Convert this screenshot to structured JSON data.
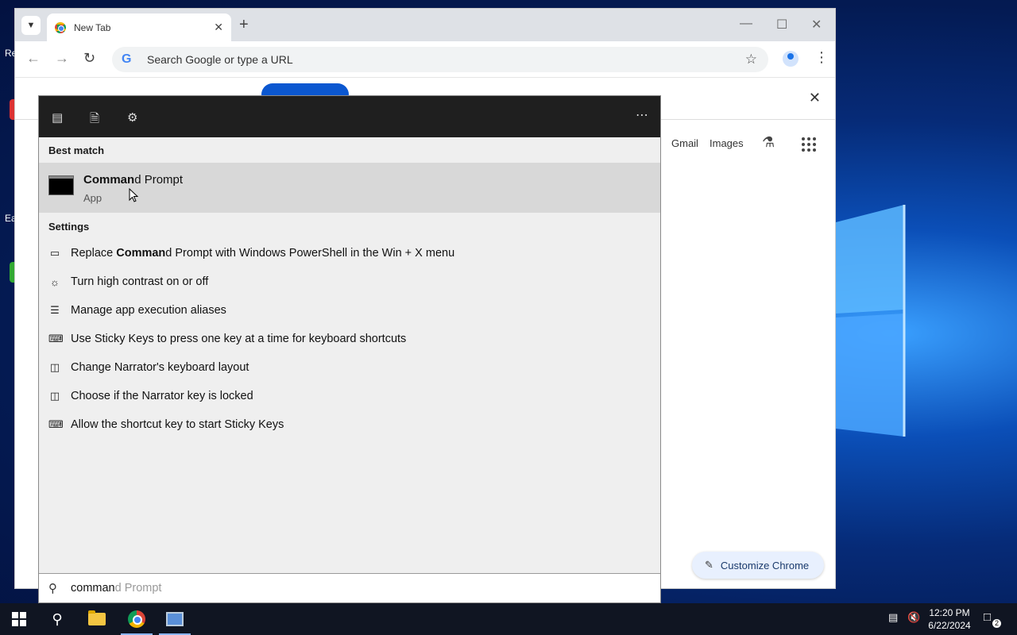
{
  "desktop": {
    "labels": [
      "Re",
      "Ea"
    ]
  },
  "browser": {
    "tab_title": "New Tab",
    "omnibox_placeholder": "Search Google or type a URL",
    "top_links": [
      "Gmail",
      "Images"
    ],
    "customize_label": "Customize Chrome"
  },
  "search_panel": {
    "best_match_heading": "Best match",
    "best_match": {
      "title_bold": "Comman",
      "title_rest": "d Prompt",
      "subtitle": "App"
    },
    "settings_heading": "Settings",
    "settings": [
      {
        "icon": "keyboard-icon",
        "pre": "Replace ",
        "bold": "Comman",
        "post": "d Prompt with Windows PowerShell in the Win + X menu"
      },
      {
        "icon": "sun-icon",
        "pre": "Turn high contrast on or off",
        "bold": "",
        "post": ""
      },
      {
        "icon": "list-icon",
        "pre": "Manage app execution aliases",
        "bold": "",
        "post": ""
      },
      {
        "icon": "keyboard-icon",
        "pre": "Use Sticky Keys to press one key at a time for keyboard shortcuts",
        "bold": "",
        "post": ""
      },
      {
        "icon": "narrator-icon",
        "pre": "Change Narrator's keyboard layout",
        "bold": "",
        "post": ""
      },
      {
        "icon": "narrator-icon",
        "pre": "Choose if the Narrator key is locked",
        "bold": "",
        "post": ""
      },
      {
        "icon": "keyboard-icon",
        "pre": "Allow the shortcut key to start Sticky Keys",
        "bold": "",
        "post": ""
      }
    ],
    "query_typed": "comman",
    "query_ghost": "d Prompt"
  },
  "taskbar": {
    "time": "12:20 PM",
    "date": "6/22/2024",
    "notification_count": "2"
  }
}
